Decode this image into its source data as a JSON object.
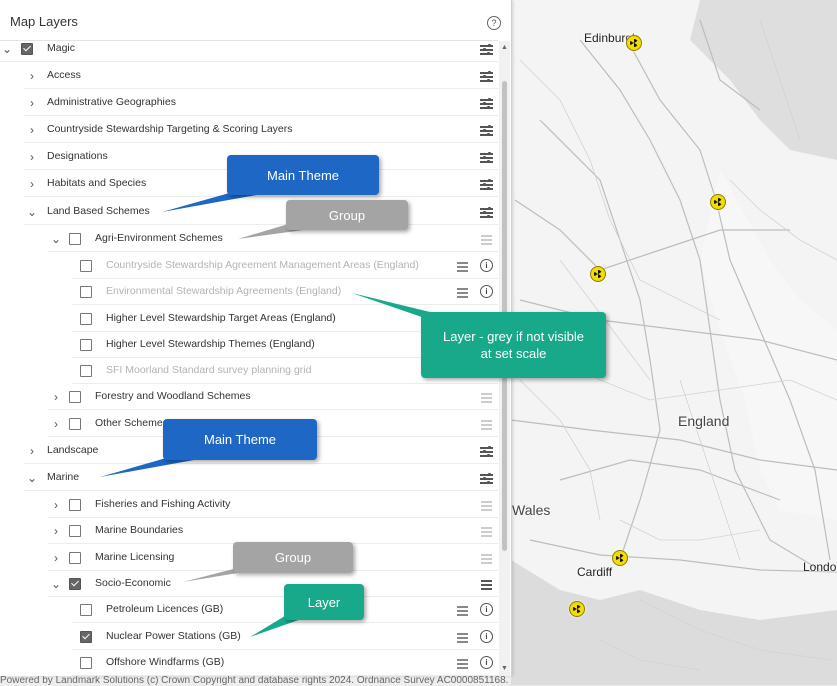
{
  "panel": {
    "title": "Map Layers",
    "help_symbol": "?",
    "info_symbol": "i"
  },
  "tree": [
    {
      "label": "Magic",
      "chevron": "⌄",
      "checkbox": "checked",
      "options": "filter",
      "grey": false
    },
    {
      "label": "Access",
      "chevron": "›",
      "checkbox": "none",
      "options": "filter"
    },
    {
      "label": "Administrative Geographies",
      "chevron": "›",
      "checkbox": "none",
      "options": "filter"
    },
    {
      "label": "Countryside Stewardship Targeting & Scoring Layers",
      "chevron": "›",
      "checkbox": "none",
      "options": "filter"
    },
    {
      "label": "Designations",
      "chevron": "›",
      "checkbox": "none",
      "options": "filter"
    },
    {
      "label": "Habitats and Species",
      "chevron": "›",
      "checkbox": "none",
      "options": "filter"
    },
    {
      "label": "Land Based Schemes",
      "chevron": "⌄",
      "checkbox": "none",
      "options": "filter"
    },
    {
      "label": "Agri-Environment Schemes",
      "chevron": "⌄",
      "checkbox": "unchecked",
      "options": "menu-light"
    },
    {
      "label": "Countryside Stewardship Agreement Management Areas (England)",
      "checkbox": "unchecked",
      "options": "menu-info",
      "grey": true
    },
    {
      "label": "Environmental Stewardship Agreements (England)",
      "checkbox": "unchecked",
      "options": "menu-info",
      "grey": true
    },
    {
      "label": "Higher Level Stewardship Target Areas (England)",
      "checkbox": "unchecked",
      "options": "none"
    },
    {
      "label": "Higher Level Stewardship Themes (England)",
      "checkbox": "unchecked",
      "options": "none"
    },
    {
      "label": "SFI Moorland Standard survey planning grid",
      "checkbox": "unchecked",
      "options": "none",
      "grey": true
    },
    {
      "label": "Forestry and Woodland Schemes",
      "chevron": "›",
      "checkbox": "unchecked",
      "options": "menu-light"
    },
    {
      "label": "Other Schemes",
      "chevron": "›",
      "checkbox": "unchecked",
      "options": "menu-light"
    },
    {
      "label": "Landscape",
      "chevron": "›",
      "checkbox": "none",
      "options": "filter"
    },
    {
      "label": "Marine",
      "chevron": "⌄",
      "checkbox": "none",
      "options": "filter"
    },
    {
      "label": "Fisheries and Fishing Activity",
      "chevron": "›",
      "checkbox": "unchecked",
      "options": "menu-light"
    },
    {
      "label": "Marine Boundaries",
      "chevron": "›",
      "checkbox": "unchecked",
      "options": "menu-light"
    },
    {
      "label": "Marine Licensing",
      "chevron": "›",
      "checkbox": "unchecked",
      "options": "menu-light"
    },
    {
      "label": "Socio-Economic",
      "chevron": "⌄",
      "checkbox": "checked",
      "options": "menu"
    },
    {
      "label": "Petroleum Licences (GB)",
      "checkbox": "unchecked",
      "options": "menu-info"
    },
    {
      "label": "Nuclear Power Stations (GB)",
      "checkbox": "checked",
      "options": "menu-info"
    },
    {
      "label": "Offshore Windfarms (GB)",
      "checkbox": "unchecked",
      "options": "menu-info"
    }
  ],
  "callouts": {
    "main_theme_1": "Main Theme",
    "group_1": "Group",
    "layer": "Layer - grey if not visible at set scale",
    "main_theme_2": "Main Theme",
    "group_2": "Group",
    "layer_2": "Layer"
  },
  "map": {
    "places": [
      "Edinburgh",
      "England",
      "Wales",
      "Cardiff",
      "London"
    ],
    "attribution": "Powered by Landmark Solutions (c) Crown Copyright and database rights 2024. Ordnance Survey AC0000851168."
  },
  "colors": {
    "callout_blue": "#1f67c4",
    "callout_grey": "#a4a4a4",
    "callout_green": "#18a98b",
    "marker_yellow": "#f2dd00"
  }
}
